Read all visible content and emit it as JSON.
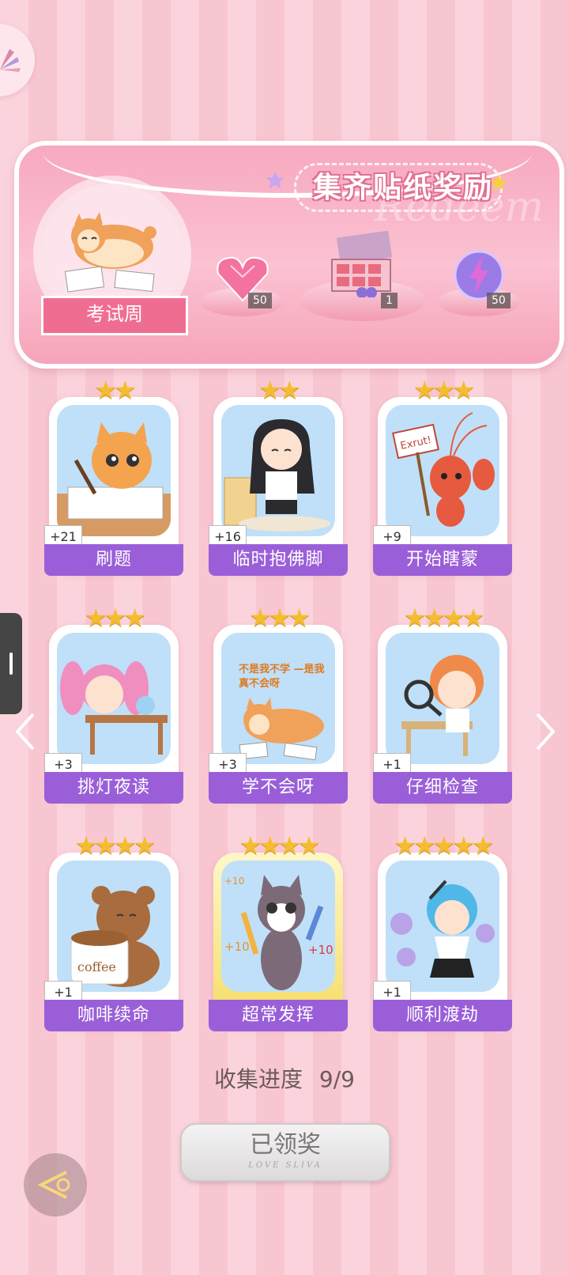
{
  "banner": {
    "title": "集齐贴纸奖励",
    "watermark": "Redeem",
    "sticker_name": "考试周",
    "rewards": [
      {
        "icon": "pink-heart-gem-icon",
        "count": "50"
      },
      {
        "icon": "gift-box-icon",
        "count": "1"
      },
      {
        "icon": "lightning-orb-icon",
        "count": "50"
      }
    ]
  },
  "stickers": [
    {
      "label": "刷题",
      "bonus": "+21",
      "stars": "★★",
      "art": "cat-studying-icon"
    },
    {
      "label": "临时抱佛脚",
      "bonus": "+16",
      "stars": "★★",
      "art": "girl-praying-icon"
    },
    {
      "label": "开始瞎蒙",
      "bonus": "+9",
      "stars": "★★★",
      "art": "lobster-sign-icon",
      "sign": "Exrut!"
    },
    {
      "label": "挑灯夜读",
      "bonus": "+3",
      "stars": "★★★",
      "art": "girl-desk-icon"
    },
    {
      "label": "学不会呀",
      "bonus": "+3",
      "stars": "★★★",
      "art": "shiba-lying-icon",
      "caption": "不是我不学 —是我真不会呀"
    },
    {
      "label": "仔细检查",
      "bonus": "+1",
      "stars": "★★★★",
      "art": "girl-magnifier-icon"
    },
    {
      "label": "咖啡续命",
      "bonus": "+1",
      "stars": "★★★★",
      "art": "bear-coffee-icon",
      "cup_text": "coffee"
    },
    {
      "label": "超常发挥",
      "bonus": "",
      "stars": "★★★★",
      "art": "cat-pencils-icon",
      "marks": [
        "+10",
        "+10",
        "+10"
      ]
    },
    {
      "label": "顺利渡劫",
      "bonus": "+1",
      "stars": "★★★★★",
      "art": "girl-letters-icon"
    }
  ],
  "progress": {
    "label": "收集进度",
    "value": "9/9"
  },
  "claim_button": {
    "label": "已领奖",
    "subtitle": "LOVE SLIVA"
  },
  "colors": {
    "label_purple": "#9a5fd8",
    "star_gold": "#f4bd2f",
    "banner_pink": "#f7a9bf"
  }
}
